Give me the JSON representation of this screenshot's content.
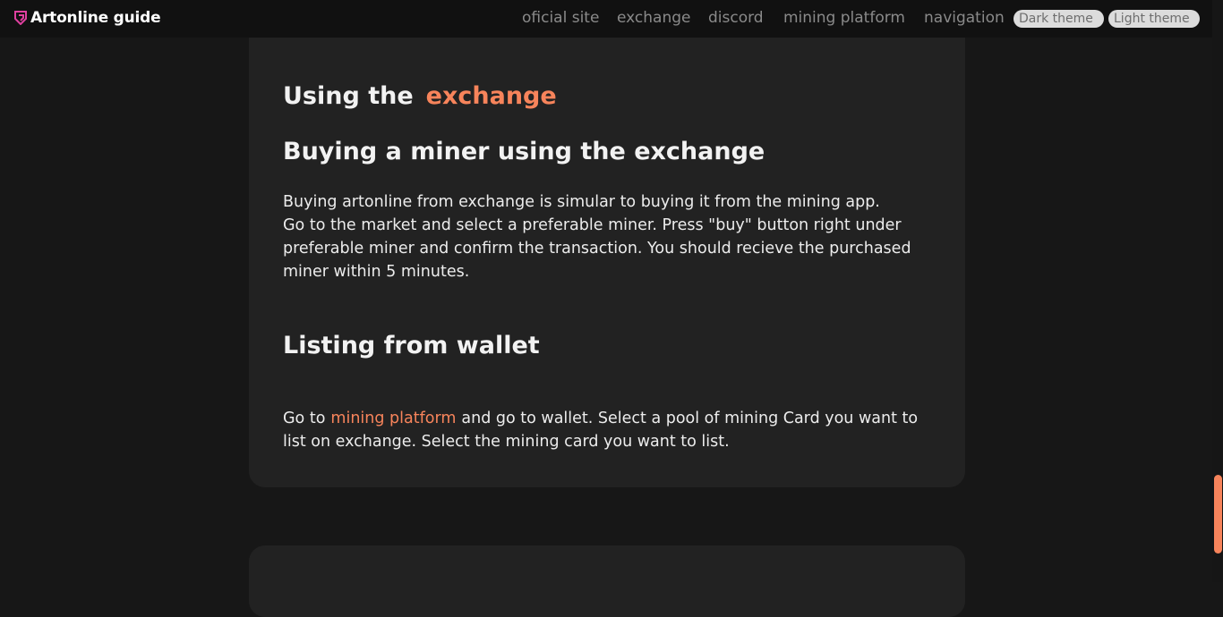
{
  "header": {
    "brand": "Artonline guide",
    "nav": [
      "oficial site",
      "exchange",
      "discord",
      "mining platform",
      "navigation"
    ],
    "themes": [
      "Dark theme",
      "Light theme"
    ]
  },
  "section": {
    "title_prefix": "Using the",
    "title_link": "exchange",
    "buying": {
      "heading": "Buying a miner using the exchange",
      "line1": "Buying artonline from exchange is simular to buying it from the mining app.",
      "line2": "Go to the market and select a preferable miner. Press \"buy\" button right under preferable miner and confirm the transaction. You should recieve the purchased miner within 5 minutes."
    },
    "listing": {
      "heading": "Listing from wallet",
      "text_before": "Go to",
      "link": "mining platform",
      "text_after": "and go to wallet. Select a pool of mining Card you want to list on exchange. Select the mining card you want to list."
    }
  },
  "colors": {
    "accent": "#f7845b",
    "brand_icon": "#e040a0",
    "background": "#171717",
    "card": "#222222"
  },
  "icons": {
    "brand": "artonline-logo-icon"
  }
}
